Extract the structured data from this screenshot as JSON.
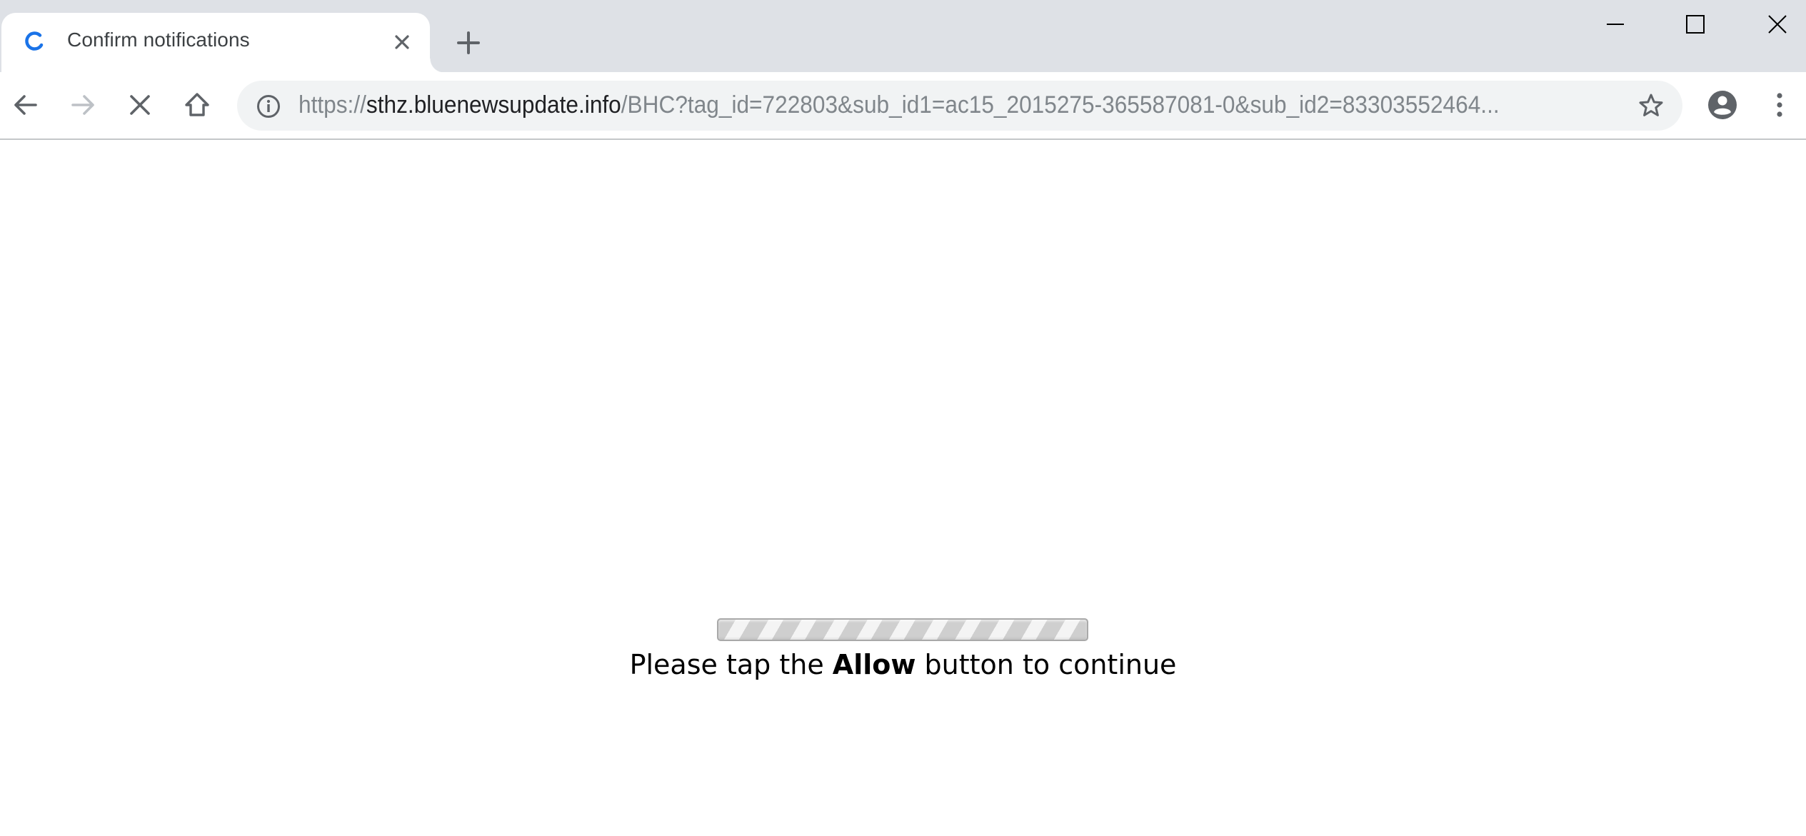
{
  "browser": {
    "tab": {
      "title": "Confirm notifications",
      "loading": true,
      "icon": "loading-spinner-icon",
      "close_icon": "close-icon"
    },
    "new_tab_icon": "plus-icon",
    "window_controls": {
      "minimize": "minimize-icon",
      "maximize": "maximize-icon",
      "close": "close-icon"
    },
    "toolbar": {
      "back_icon": "arrow-left-icon",
      "forward_icon": "arrow-right-icon",
      "forward_enabled": false,
      "stop_icon": "stop-icon",
      "home_icon": "home-icon",
      "profile_icon": "account-circle-icon",
      "menu_icon": "more-vert-icon"
    },
    "omnibox": {
      "security_icon": "info-icon",
      "url_scheme": "https://",
      "url_host": "sthz.bluenewsupdate.info",
      "url_rest": "/BHC?tag_id=722803&sub_id1=ac15_2015275-365587081-0&sub_id2=83303552464...",
      "bookmark_icon": "star-outline-icon"
    }
  },
  "page": {
    "progress": {
      "style": "striped-indeterminate"
    },
    "message": {
      "before": "Please tap the ",
      "emphasis": "Allow",
      "after": " button to continue"
    }
  },
  "colors": {
    "tabstrip_bg": "#dee1e6",
    "omnibox_bg": "#f1f3f4",
    "spinner_blue": "#1a73e8",
    "icon_gray": "#5f6368",
    "icon_disabled": "#bdc1c6",
    "url_dim": "#80868b",
    "url_host": "#202124"
  }
}
